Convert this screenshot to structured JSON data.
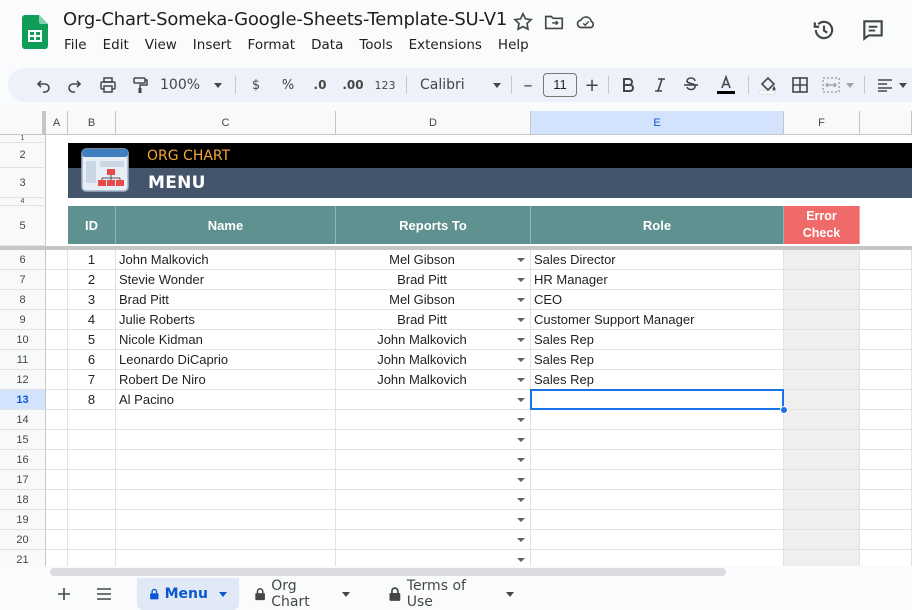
{
  "title_bar": {
    "doc_title": "Org-Chart-Someka-Google-Sheets-Template-SU-V1",
    "menu": [
      "File",
      "Edit",
      "View",
      "Insert",
      "Format",
      "Data",
      "Tools",
      "Extensions",
      "Help"
    ]
  },
  "toolbar": {
    "zoom": "100%",
    "currency": "$",
    "percent": "%",
    "dec_decrease": ".0",
    "dec_increase": ".00",
    "number_format": "123",
    "font": "Calibri",
    "font_size": "11",
    "minus": "–",
    "plus": "+"
  },
  "grid": {
    "columns": [
      "A",
      "B",
      "C",
      "D",
      "E",
      "F"
    ],
    "rows": [
      "1",
      "2",
      "3",
      "4",
      "5",
      "6",
      "7",
      "8",
      "9",
      "10",
      "11",
      "12",
      "13",
      "14",
      "15",
      "16",
      "17",
      "18",
      "19",
      "20",
      "21"
    ],
    "selected_column": "E",
    "selected_row": "13"
  },
  "sheet": {
    "org_title": "ORG CHART",
    "menu_title": "MENU",
    "headers": {
      "id": "ID",
      "name": "Name",
      "reports_to": "Reports To",
      "role": "Role",
      "error_line1": "Error",
      "error_line2": "Check"
    },
    "rows": [
      {
        "id": "1",
        "name": "John Malkovich",
        "reports_to": "Mel Gibson",
        "role": "Sales Director"
      },
      {
        "id": "2",
        "name": "Stevie Wonder",
        "reports_to": "Brad Pitt",
        "role": "HR Manager"
      },
      {
        "id": "3",
        "name": "Brad Pitt",
        "reports_to": "Mel Gibson",
        "role": "CEO"
      },
      {
        "id": "4",
        "name": "Julie Roberts",
        "reports_to": "Brad Pitt",
        "role": "Customer Support Manager"
      },
      {
        "id": "5",
        "name": "Nicole Kidman",
        "reports_to": "John Malkovich",
        "role": "Sales Rep"
      },
      {
        "id": "6",
        "name": "Leonardo DiCaprio",
        "reports_to": "John Malkovich",
        "role": "Sales Rep"
      },
      {
        "id": "7",
        "name": "Robert De Niro",
        "reports_to": "John Malkovich",
        "role": "Sales Rep"
      },
      {
        "id": "8",
        "name": "Al Pacino",
        "reports_to": "",
        "role": ""
      },
      {
        "id": "",
        "name": "",
        "reports_to": "",
        "role": ""
      },
      {
        "id": "",
        "name": "",
        "reports_to": "",
        "role": ""
      },
      {
        "id": "",
        "name": "",
        "reports_to": "",
        "role": ""
      },
      {
        "id": "",
        "name": "",
        "reports_to": "",
        "role": ""
      },
      {
        "id": "",
        "name": "",
        "reports_to": "",
        "role": ""
      },
      {
        "id": "",
        "name": "",
        "reports_to": "",
        "role": ""
      },
      {
        "id": "",
        "name": "",
        "reports_to": "",
        "role": ""
      },
      {
        "id": "",
        "name": "",
        "reports_to": "",
        "role": ""
      }
    ]
  },
  "tabs": [
    {
      "label": "Menu",
      "active": true
    },
    {
      "label": "Org Chart",
      "active": false
    },
    {
      "label": "Terms of Use",
      "active": false
    }
  ],
  "colors": {
    "header_teal": "#5e918f",
    "error_red": "#f06a6a",
    "banner_gray": "#44546a",
    "org_title_orange": "#f4a636",
    "selection_blue": "#1a73e8"
  }
}
